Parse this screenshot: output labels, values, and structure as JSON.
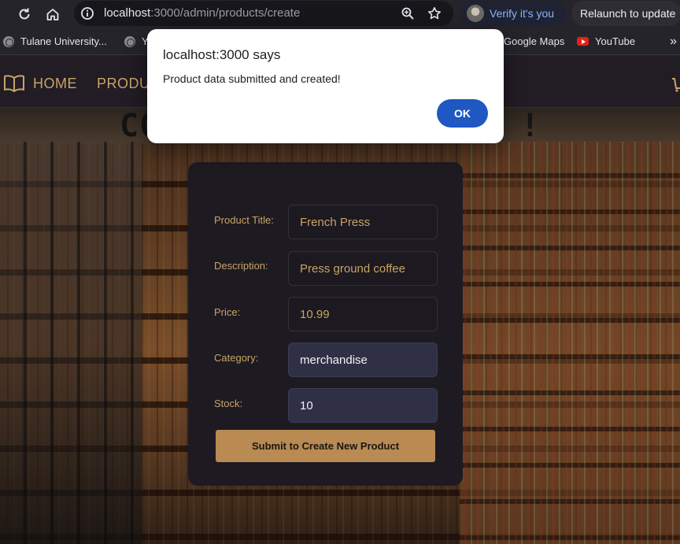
{
  "browser": {
    "url_host": "localhost",
    "url_rest": ":3000/admin/products/create",
    "verify_label": "Verify it's you",
    "relaunch_label": "Relaunch to update",
    "more_bookmarks": "»"
  },
  "bookmarks": [
    {
      "label": "Tulane University...",
      "icon": "globe-icon"
    },
    {
      "label": "Y",
      "icon": "globe-icon"
    },
    {
      "label": "Google Maps",
      "icon": "maps-icon"
    },
    {
      "label": "YouTube",
      "icon": "youtube-icon"
    }
  ],
  "site_nav": {
    "home": "HOME",
    "products": "PRODUC"
  },
  "page_heading_left": "CO",
  "page_heading_right": "D !",
  "form": {
    "fields": [
      {
        "label": "Product Title:",
        "value": "French Press"
      },
      {
        "label": "Description:",
        "value": "Press ground coffee"
      },
      {
        "label": "Price:",
        "value": "10.99"
      },
      {
        "label": "Category:",
        "value": "merchandise"
      },
      {
        "label": "Stock:",
        "value": "10"
      }
    ],
    "submit_label": "Submit to Create New Product"
  },
  "dialog": {
    "title": "localhost:3000 says",
    "message": "Product data submitted and created!",
    "ok_label": "OK"
  },
  "colors": {
    "accent_gold": "#c8a466",
    "button_tan": "#b98a52",
    "dialog_blue": "#1f57c3",
    "card_bg": "#1e1a22"
  }
}
